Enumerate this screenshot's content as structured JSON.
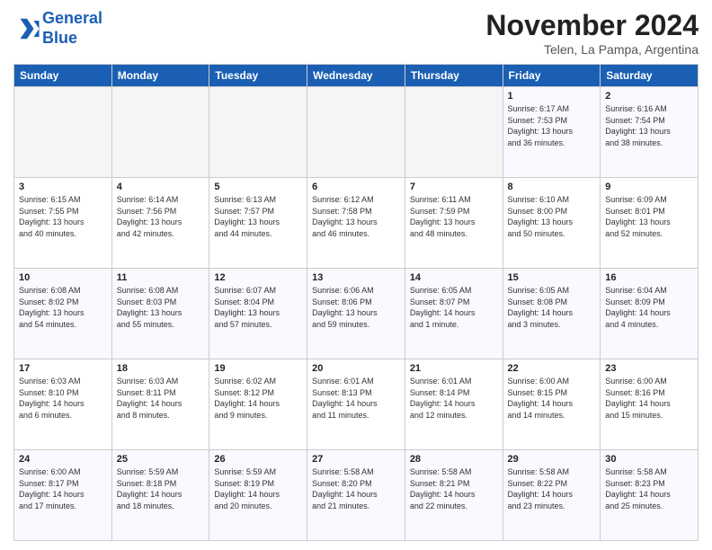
{
  "header": {
    "logo_line1": "General",
    "logo_line2": "Blue",
    "month": "November 2024",
    "location": "Telen, La Pampa, Argentina"
  },
  "days_of_week": [
    "Sunday",
    "Monday",
    "Tuesday",
    "Wednesday",
    "Thursday",
    "Friday",
    "Saturday"
  ],
  "weeks": [
    [
      {
        "day": "",
        "info": ""
      },
      {
        "day": "",
        "info": ""
      },
      {
        "day": "",
        "info": ""
      },
      {
        "day": "",
        "info": ""
      },
      {
        "day": "",
        "info": ""
      },
      {
        "day": "1",
        "info": "Sunrise: 6:17 AM\nSunset: 7:53 PM\nDaylight: 13 hours\nand 36 minutes."
      },
      {
        "day": "2",
        "info": "Sunrise: 6:16 AM\nSunset: 7:54 PM\nDaylight: 13 hours\nand 38 minutes."
      }
    ],
    [
      {
        "day": "3",
        "info": "Sunrise: 6:15 AM\nSunset: 7:55 PM\nDaylight: 13 hours\nand 40 minutes."
      },
      {
        "day": "4",
        "info": "Sunrise: 6:14 AM\nSunset: 7:56 PM\nDaylight: 13 hours\nand 42 minutes."
      },
      {
        "day": "5",
        "info": "Sunrise: 6:13 AM\nSunset: 7:57 PM\nDaylight: 13 hours\nand 44 minutes."
      },
      {
        "day": "6",
        "info": "Sunrise: 6:12 AM\nSunset: 7:58 PM\nDaylight: 13 hours\nand 46 minutes."
      },
      {
        "day": "7",
        "info": "Sunrise: 6:11 AM\nSunset: 7:59 PM\nDaylight: 13 hours\nand 48 minutes."
      },
      {
        "day": "8",
        "info": "Sunrise: 6:10 AM\nSunset: 8:00 PM\nDaylight: 13 hours\nand 50 minutes."
      },
      {
        "day": "9",
        "info": "Sunrise: 6:09 AM\nSunset: 8:01 PM\nDaylight: 13 hours\nand 52 minutes."
      }
    ],
    [
      {
        "day": "10",
        "info": "Sunrise: 6:08 AM\nSunset: 8:02 PM\nDaylight: 13 hours\nand 54 minutes."
      },
      {
        "day": "11",
        "info": "Sunrise: 6:08 AM\nSunset: 8:03 PM\nDaylight: 13 hours\nand 55 minutes."
      },
      {
        "day": "12",
        "info": "Sunrise: 6:07 AM\nSunset: 8:04 PM\nDaylight: 13 hours\nand 57 minutes."
      },
      {
        "day": "13",
        "info": "Sunrise: 6:06 AM\nSunset: 8:06 PM\nDaylight: 13 hours\nand 59 minutes."
      },
      {
        "day": "14",
        "info": "Sunrise: 6:05 AM\nSunset: 8:07 PM\nDaylight: 14 hours\nand 1 minute."
      },
      {
        "day": "15",
        "info": "Sunrise: 6:05 AM\nSunset: 8:08 PM\nDaylight: 14 hours\nand 3 minutes."
      },
      {
        "day": "16",
        "info": "Sunrise: 6:04 AM\nSunset: 8:09 PM\nDaylight: 14 hours\nand 4 minutes."
      }
    ],
    [
      {
        "day": "17",
        "info": "Sunrise: 6:03 AM\nSunset: 8:10 PM\nDaylight: 14 hours\nand 6 minutes."
      },
      {
        "day": "18",
        "info": "Sunrise: 6:03 AM\nSunset: 8:11 PM\nDaylight: 14 hours\nand 8 minutes."
      },
      {
        "day": "19",
        "info": "Sunrise: 6:02 AM\nSunset: 8:12 PM\nDaylight: 14 hours\nand 9 minutes."
      },
      {
        "day": "20",
        "info": "Sunrise: 6:01 AM\nSunset: 8:13 PM\nDaylight: 14 hours\nand 11 minutes."
      },
      {
        "day": "21",
        "info": "Sunrise: 6:01 AM\nSunset: 8:14 PM\nDaylight: 14 hours\nand 12 minutes."
      },
      {
        "day": "22",
        "info": "Sunrise: 6:00 AM\nSunset: 8:15 PM\nDaylight: 14 hours\nand 14 minutes."
      },
      {
        "day": "23",
        "info": "Sunrise: 6:00 AM\nSunset: 8:16 PM\nDaylight: 14 hours\nand 15 minutes."
      }
    ],
    [
      {
        "day": "24",
        "info": "Sunrise: 6:00 AM\nSunset: 8:17 PM\nDaylight: 14 hours\nand 17 minutes."
      },
      {
        "day": "25",
        "info": "Sunrise: 5:59 AM\nSunset: 8:18 PM\nDaylight: 14 hours\nand 18 minutes."
      },
      {
        "day": "26",
        "info": "Sunrise: 5:59 AM\nSunset: 8:19 PM\nDaylight: 14 hours\nand 20 minutes."
      },
      {
        "day": "27",
        "info": "Sunrise: 5:58 AM\nSunset: 8:20 PM\nDaylight: 14 hours\nand 21 minutes."
      },
      {
        "day": "28",
        "info": "Sunrise: 5:58 AM\nSunset: 8:21 PM\nDaylight: 14 hours\nand 22 minutes."
      },
      {
        "day": "29",
        "info": "Sunrise: 5:58 AM\nSunset: 8:22 PM\nDaylight: 14 hours\nand 23 minutes."
      },
      {
        "day": "30",
        "info": "Sunrise: 5:58 AM\nSunset: 8:23 PM\nDaylight: 14 hours\nand 25 minutes."
      }
    ]
  ]
}
